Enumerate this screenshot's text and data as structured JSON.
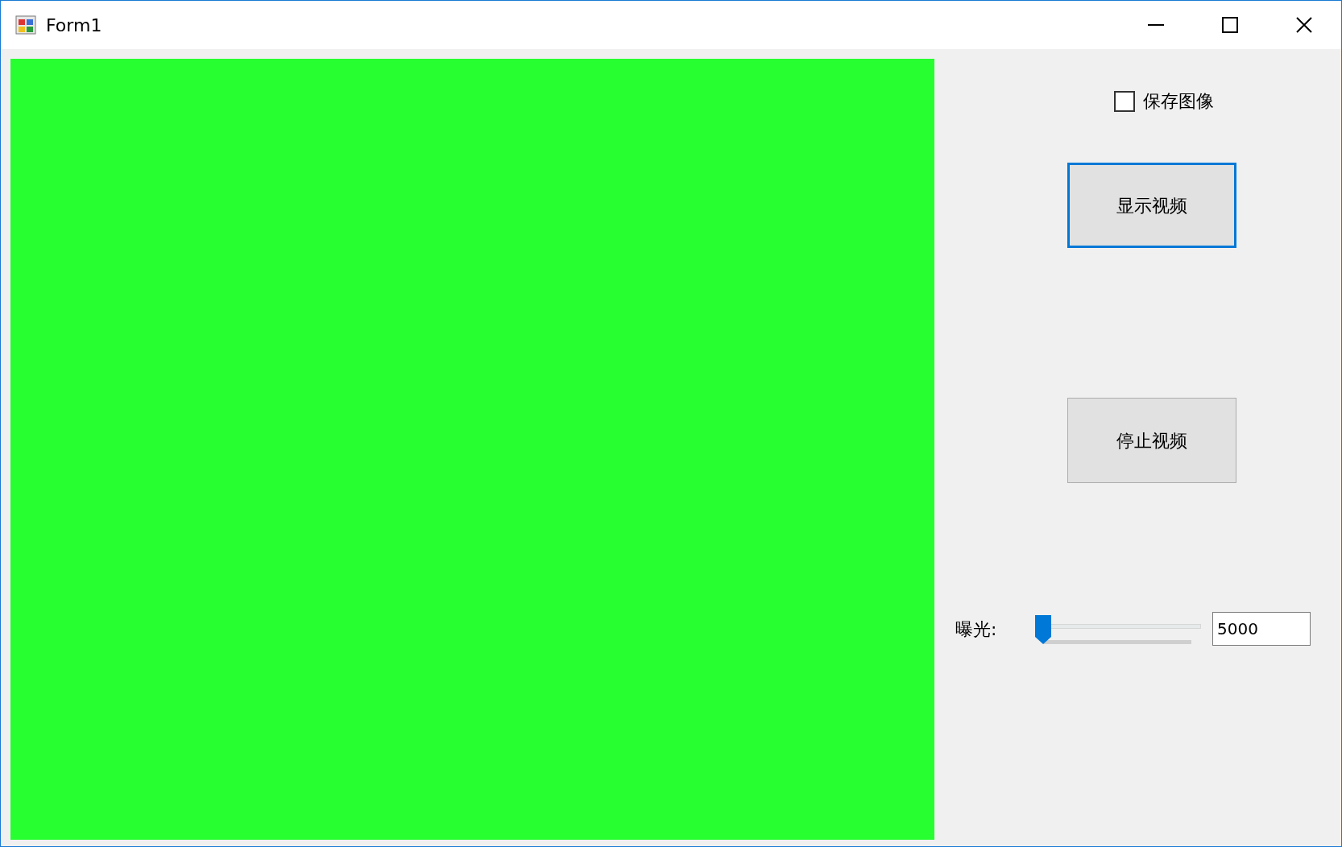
{
  "window": {
    "title": "Form1"
  },
  "save_image": {
    "label": "保存图像",
    "checked": false
  },
  "buttons": [
    {
      "label": "显示视频",
      "focused": true
    },
    {
      "label": "停止视频",
      "focused": false
    }
  ],
  "exposure": {
    "label": "曝光:",
    "level": 0,
    "value": "5000"
  }
}
